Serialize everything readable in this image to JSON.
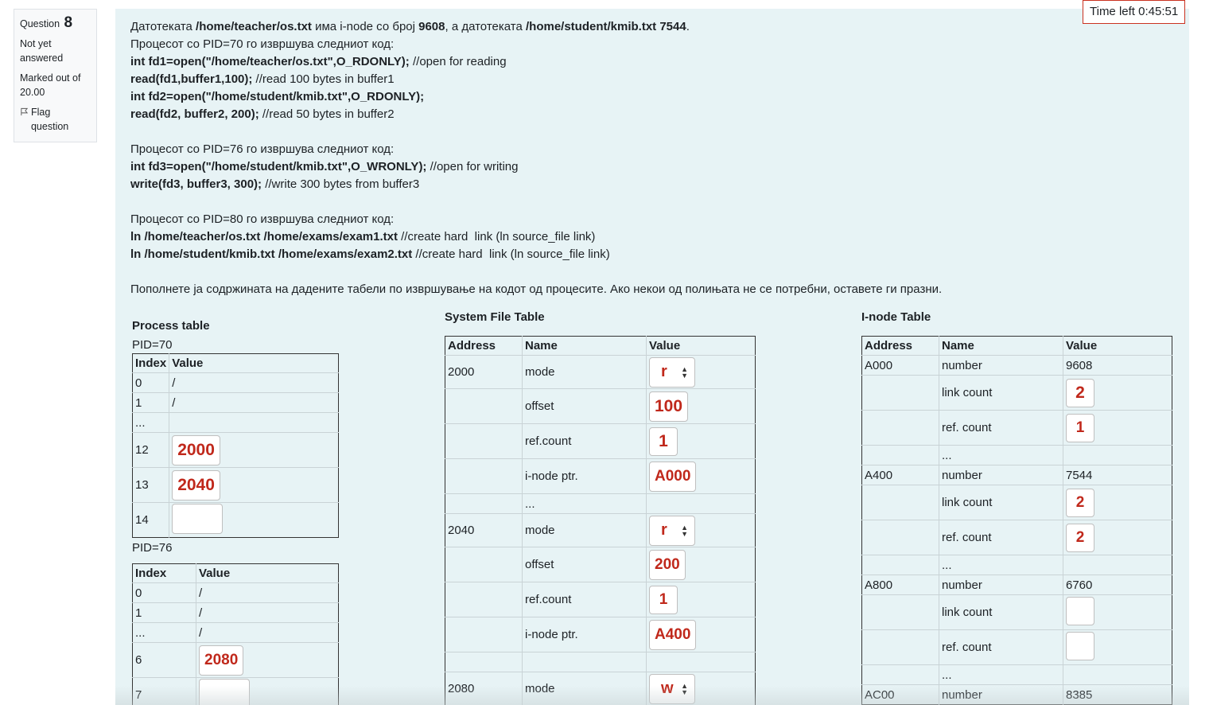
{
  "question": {
    "label": "Question",
    "number": "8",
    "state": "Not yet answered",
    "grade": "Marked out of 20.00",
    "flag": "Flag question"
  },
  "timer": "Time left 0:45:51",
  "text": {
    "l1_a": "Датотеката ",
    "l1_b": "/home/teacher/os.txt",
    "l1_c": " има i-node со број ",
    "l1_d": "9608",
    "l1_e": ", а датотеката ",
    "l1_f": "/home/student/kmib.txt 7544",
    "l1_g": ".",
    "l2": "Процесот со PID=70 го извршува следниот код:",
    "l3_a": "int fd1=open(\"/home/teacher/os.txt\",O_RDONLY);",
    "l3_b": " //open for reading",
    "l4_a": "read(fd1,buffer1,100);",
    "l4_b": " //read 100 bytes in buffer1",
    "l5_a": "int fd2=open(\"/home/student/kmib.txt\",O_RDONLY);",
    "l6_a": "read(fd2, buffer2, 200);",
    "l6_b": " //read 50 bytes in buffer2",
    "l8": "Процесот со PID=76 го извршува следниот код:",
    "l9_a": "int fd3=open(\"/home/student/kmib.txt\",O_WRONLY);",
    "l9_b": " //open for writing",
    "l10_a": "write(fd3, buffer3, 300);",
    "l10_b": " //write 300 bytes from buffer3",
    "l12": "Процесот со PID=80 го извршува следниот код:",
    "l13_a": "ln /home/teacher/os.txt /home/exams/exam1.txt",
    "l13_b": " //create hard  link (ln source_file link)",
    "l14_a": "ln /home/student/kmib.txt /home/exams/exam2.txt",
    "l14_b": " //create hard  link (ln source_file link)",
    "l16": "Пополнете ја содржината на дадените табели по извршување на кодот од процесите. Ако некои од полињата не се потребни, оставете ги празни."
  },
  "process_table": {
    "title": "Process table",
    "pid70": "PID=70",
    "pid76": "PID=76",
    "col_index": "Index",
    "col_value": "Value",
    "t70": {
      "r0": {
        "i": "0",
        "v": "/"
      },
      "r1": {
        "i": "1",
        "v": "/"
      },
      "r2": {
        "i": "...",
        "v": ""
      },
      "r12": {
        "i": "12",
        "v": "2000"
      },
      "r13": {
        "i": "13",
        "v": "2040"
      },
      "r14": {
        "i": "14",
        "v": ""
      }
    },
    "t76": {
      "r0": {
        "i": "0",
        "v": "/"
      },
      "r1": {
        "i": "1",
        "v": "/"
      },
      "r2": {
        "i": "...",
        "v": "/"
      },
      "r6": {
        "i": "6",
        "v": "2080"
      },
      "r7": {
        "i": "7",
        "v": ""
      }
    }
  },
  "sft": {
    "title": "System File Table",
    "col_address": "Address",
    "col_name": "Name",
    "col_value": "Value",
    "a2000": "2000",
    "a2040": "2040",
    "a2080": "2080",
    "mode": "mode",
    "offset": "offset",
    "refcount": "ref.count",
    "inode_ptr": "i-node ptr.",
    "dots": "...",
    "v2000": {
      "mode": "r",
      "offset": "100",
      "ref": "1",
      "ptr": "A000"
    },
    "v2040": {
      "mode": "r",
      "offset": "200",
      "ref": "1",
      "ptr": "A400"
    },
    "v2080": {
      "mode": "w"
    }
  },
  "inode": {
    "title": "I-node Table",
    "col_address": "Address",
    "col_name": "Name",
    "col_value": "Value",
    "number": "number",
    "link_count": "link count",
    "ref_count": "ref. count",
    "dots": "...",
    "aA000": "A000",
    "aA400": "A400",
    "aA800": "A800",
    "aAC00": "AC00",
    "nA000": "9608",
    "nA400": "7544",
    "nA800": "6760",
    "nAC00": "8385",
    "vA000": {
      "link": "2",
      "ref": "1"
    },
    "vA400": {
      "link": "2",
      "ref": "2"
    },
    "vA800": {
      "link": "",
      "ref": ""
    }
  },
  "colors": {
    "answer": "#c0281b",
    "background": "#e7f3f5",
    "timer_border": "#ca3120"
  },
  "icons": {
    "flag": "flag-icon",
    "select_arrow": "updown-arrow-icon"
  }
}
